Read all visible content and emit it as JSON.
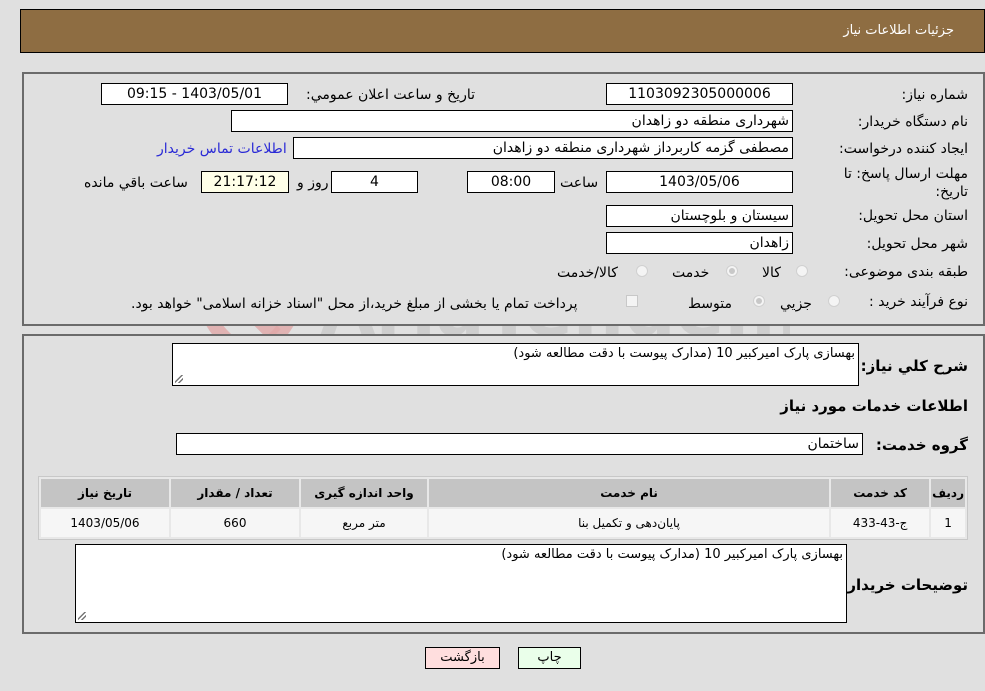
{
  "header": {
    "title": "جزئیات اطلاعات نیاز"
  },
  "form": {
    "need_number": {
      "label": "شماره نیاز:",
      "value": "1103092305000006"
    },
    "announce_datetime": {
      "label": "تاریخ و ساعت اعلان عمومي:",
      "value": "1403/05/01 - 09:15"
    },
    "buyer_org": {
      "label": "نام دستگاه خریدار:",
      "value": "شهرداری منطقه دو زاهدان"
    },
    "requester": {
      "label": "ایجاد کننده درخواست:",
      "value": "مصطفی گزمه کاربرداز شهرداری منطقه دو زاهدان",
      "contact_link": "اطلاعات تماس خریدار"
    },
    "deadline": {
      "label": "مهلت ارسال پاسخ: تا تاریخ:",
      "date": "1403/05/06",
      "time_label": "ساعت",
      "time": "08:00",
      "days": "4",
      "days_label": "روز و",
      "remaining": "21:17:12",
      "remaining_label": "ساعت باقي مانده"
    },
    "province": {
      "label": "استان محل تحویل:",
      "value": "سیستان و بلوچستان"
    },
    "city": {
      "label": "شهر محل تحویل:",
      "value": "زاهدان"
    },
    "category": {
      "label": "طبقه بندی موضوعی:",
      "options": [
        "کالا",
        "خدمت",
        "کالا/خدمت"
      ],
      "selected": "خدمت"
    },
    "purchase_type": {
      "label": "نوع فرآیند خرید :",
      "options": [
        "جزیي",
        "متوسط"
      ],
      "selected": "متوسط",
      "treasury_note": "پرداخت تمام یا بخشی از مبلغ خرید،از محل \"اسناد خزانه اسلامی\" خواهد بود."
    }
  },
  "details": {
    "description_label": "شرح كلي نياز:",
    "description": "بهسازی پارک امیرکبیر 10 (مدارک پیوست با دقت مطالعه شود)",
    "services_heading": "اطلاعات خدمات مورد نیاز",
    "service_group_label": "گروه خدمت:",
    "service_group": "ساختمان",
    "table": {
      "headers": [
        "ردیف",
        "کد خدمت",
        "نام خدمت",
        "واحد اندازه گیری",
        "تعداد / مقدار",
        "تاریخ نیاز"
      ],
      "rows": [
        [
          "1",
          "ج-43-433",
          "پایان‌دهی و تکمیل بنا",
          "متر مربع",
          "660",
          "1403/05/06"
        ]
      ]
    },
    "buyer_notes_label": "توضیحات خریدار:",
    "buyer_notes": "بهسازی پارک امیرکبیر 10 (مدارک پیوست با دقت مطالعه شود)"
  },
  "buttons": {
    "print": "چاپ",
    "back": "بازگشت"
  },
  "colors": {
    "header_bg": "#8e6d42",
    "link": "#2a2ad6",
    "print_bg": "#eaffea",
    "back_bg": "#ffdede"
  },
  "watermark": "AriaTender.neT"
}
